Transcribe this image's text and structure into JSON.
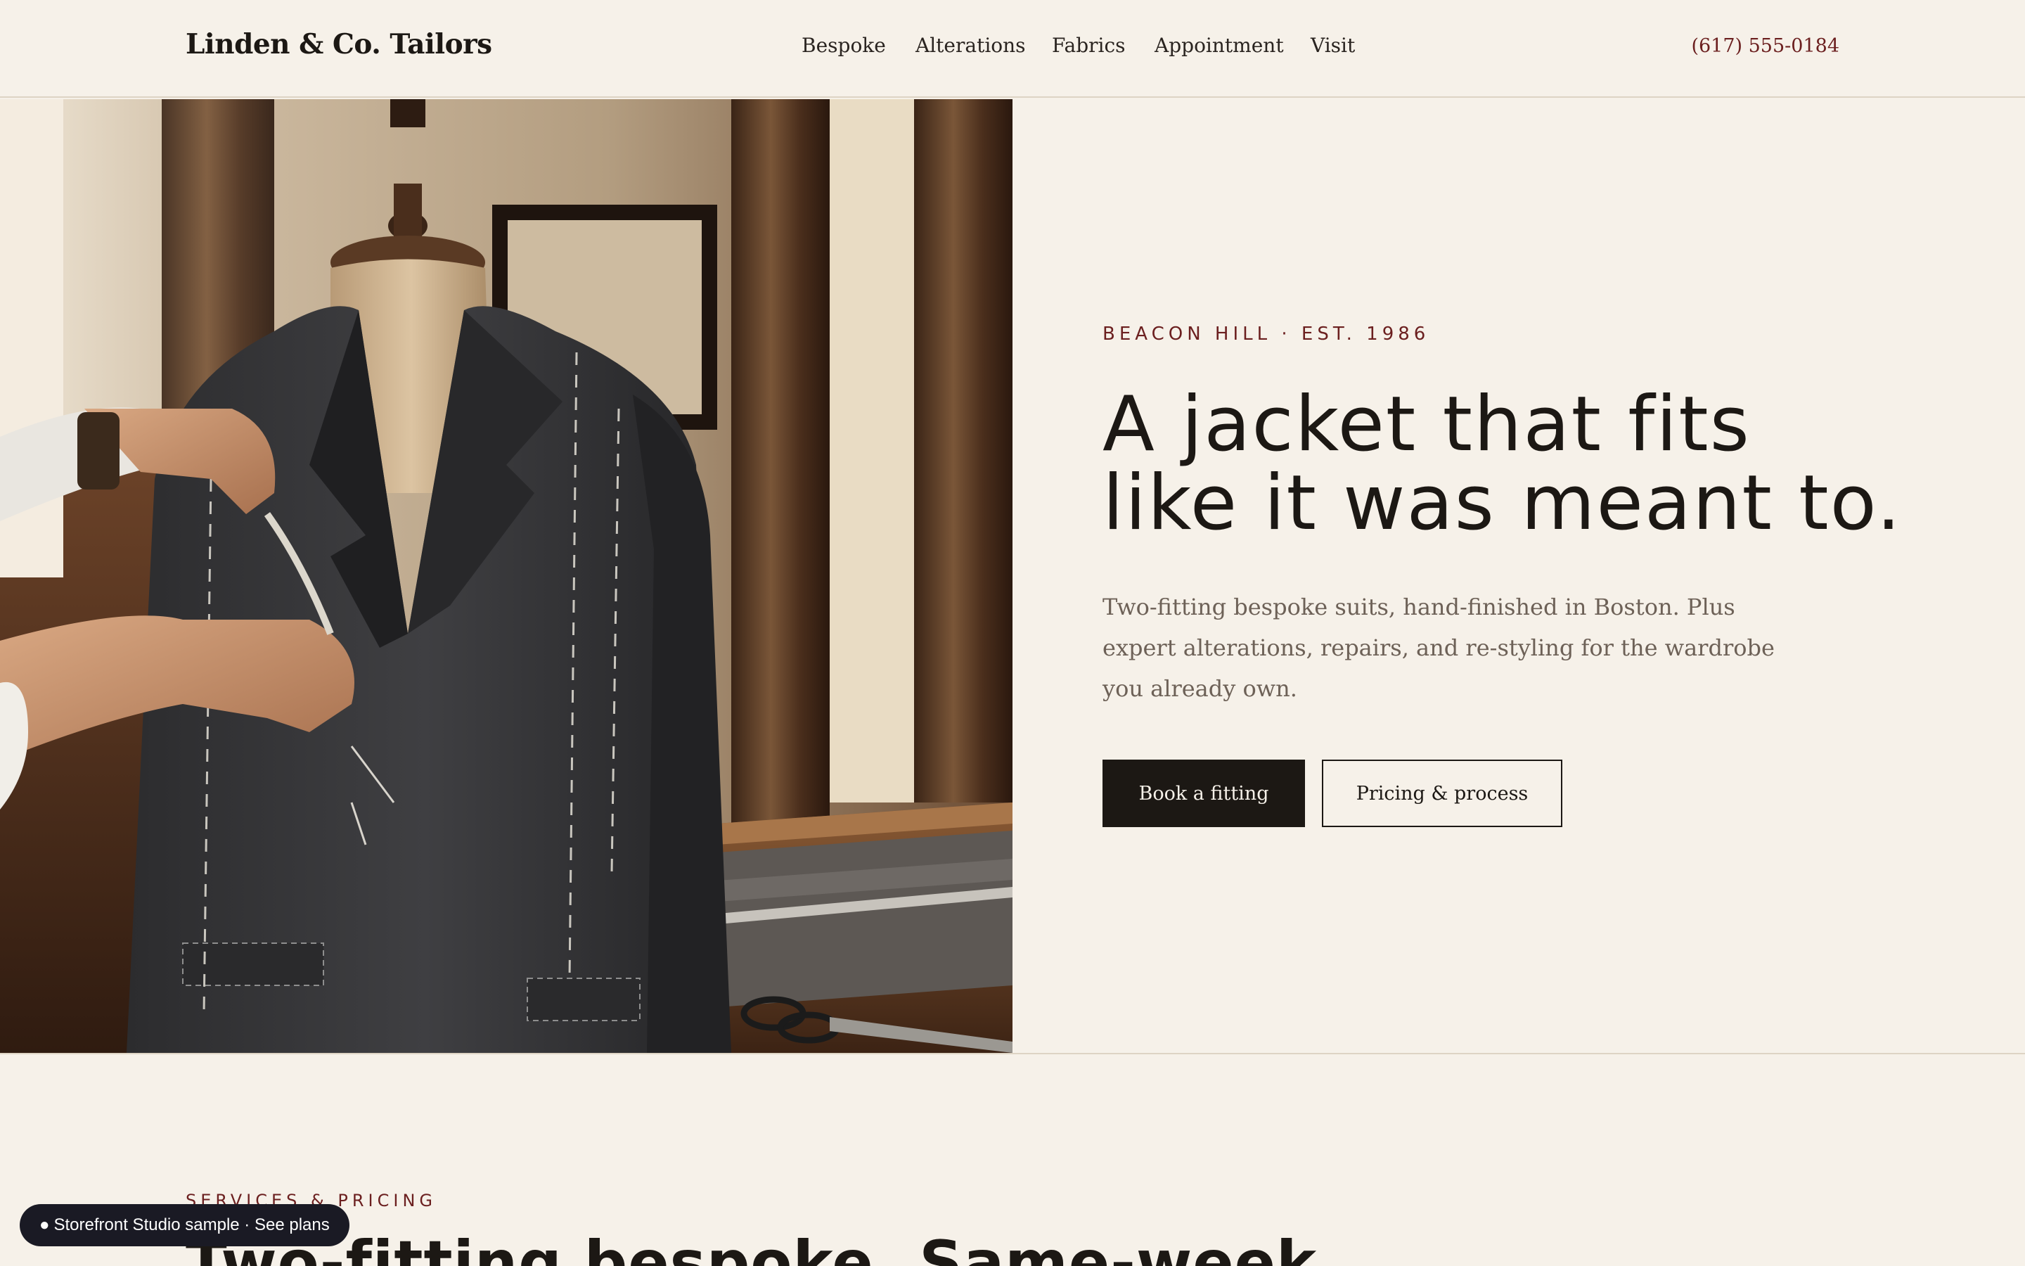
{
  "header": {
    "brand": "Linden & Co. Tailors",
    "nav": [
      "Bespoke",
      "Alterations",
      "Fabrics",
      "Appointment",
      "Visit"
    ],
    "phone": "(617) 555-0184"
  },
  "hero": {
    "eyebrow": "BEACON HILL · EST. 1986",
    "headline_line1": "A jacket that fits",
    "headline_line2": "like it was meant to.",
    "lede": "Two-fitting bespoke suits, hand-finished in Boston. Plus expert alterations, repairs, and re-styling for the wardrobe you already own.",
    "primary_cta": "Book a fitting",
    "secondary_cta": "Pricing & process"
  },
  "services": {
    "eyebrow": "SERVICES & PRICING",
    "title": "Two-fitting bespoke. Same-week"
  },
  "badge": {
    "dot": "●",
    "label": "Storefront Studio sample · See plans"
  },
  "colors": {
    "background": "#f6f1e9",
    "ink": "#1c1814",
    "accent": "#6b1f1f",
    "muted": "#6d6157"
  }
}
